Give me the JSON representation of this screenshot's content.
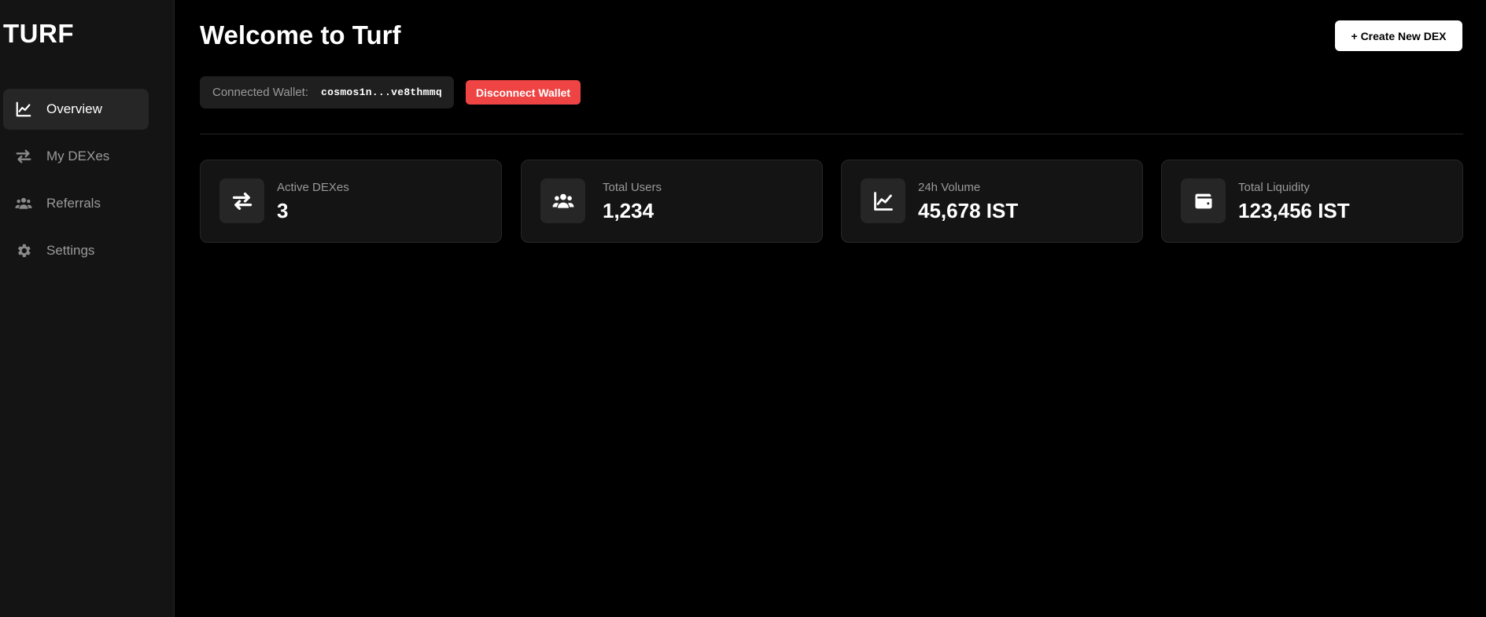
{
  "sidebar": {
    "brand": "TURF",
    "items": [
      {
        "label": "Overview",
        "icon": "chart-line-icon",
        "active": true
      },
      {
        "label": "My DEXes",
        "icon": "exchange-icon",
        "active": false
      },
      {
        "label": "Referrals",
        "icon": "users-icon",
        "active": false
      },
      {
        "label": "Settings",
        "icon": "gear-icon",
        "active": false
      }
    ]
  },
  "header": {
    "title": "Welcome to Turf",
    "create_button": "+ Create New DEX"
  },
  "wallet": {
    "label": "Connected Wallet:",
    "address": "cosmos1n...ve8thmmq",
    "disconnect_button": "Disconnect Wallet"
  },
  "stats": [
    {
      "label": "Active DEXes",
      "value": "3",
      "icon": "exchange-icon"
    },
    {
      "label": "Total Users",
      "value": "1,234",
      "icon": "users-icon"
    },
    {
      "label": "24h Volume",
      "value": "45,678 IST",
      "icon": "chart-line-icon"
    },
    {
      "label": "Total Liquidity",
      "value": "123,456 IST",
      "icon": "wallet-icon"
    }
  ],
  "colors": {
    "background": "#000000",
    "sidebar": "#141414",
    "card": "#141414",
    "accent_danger": "#ef4444",
    "muted_text": "#9a9a9a"
  }
}
